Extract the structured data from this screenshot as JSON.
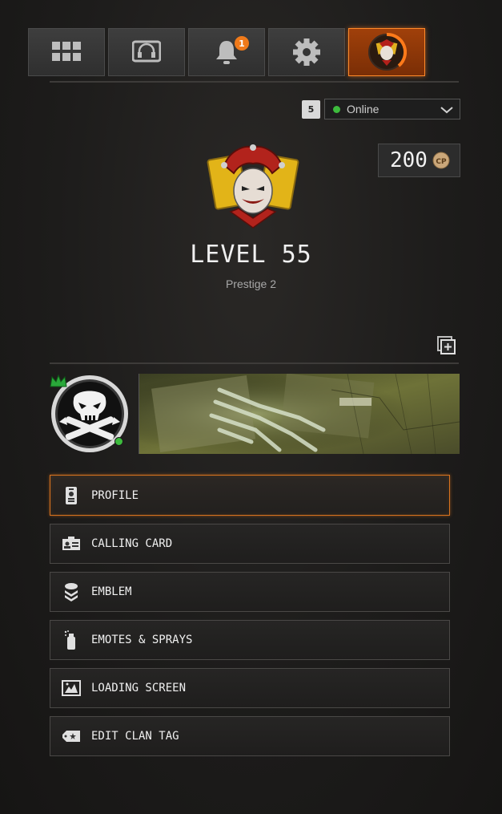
{
  "tabs": [
    {
      "name": "menu-grid",
      "icon": "grid-icon"
    },
    {
      "name": "social",
      "icon": "headset-icon"
    },
    {
      "name": "notifications",
      "icon": "bell-icon",
      "badge": "1"
    },
    {
      "name": "settings",
      "icon": "gear-icon"
    },
    {
      "name": "profile",
      "icon": "jester-avatar-icon",
      "active": true
    }
  ],
  "status": {
    "party_count": "5",
    "selected": "Online",
    "dot_color": "#3dbb3d"
  },
  "currency": {
    "amount": "200",
    "icon": "cod-points-coin-icon"
  },
  "player": {
    "level_text": "LEVEL 55",
    "prestige_text": "Prestige 2",
    "rank_icon": "jester-rank-emblem-icon"
  },
  "menu": {
    "items": [
      {
        "label": "PROFILE",
        "icon": "id-badge-icon",
        "selected": true
      },
      {
        "label": "CALLING CARD",
        "icon": "calling-card-icon"
      },
      {
        "label": "EMBLEM",
        "icon": "chevron-emblem-icon"
      },
      {
        "label": "EMOTES & SPRAYS",
        "icon": "spray-can-icon"
      },
      {
        "label": "LOADING SCREEN",
        "icon": "loading-screen-icon"
      },
      {
        "label": "EDIT CLAN TAG",
        "icon": "clan-tag-icon"
      }
    ]
  },
  "colors": {
    "accent": "#d9731f",
    "online": "#3dbb3d",
    "notification_badge": "#f07a1a"
  }
}
